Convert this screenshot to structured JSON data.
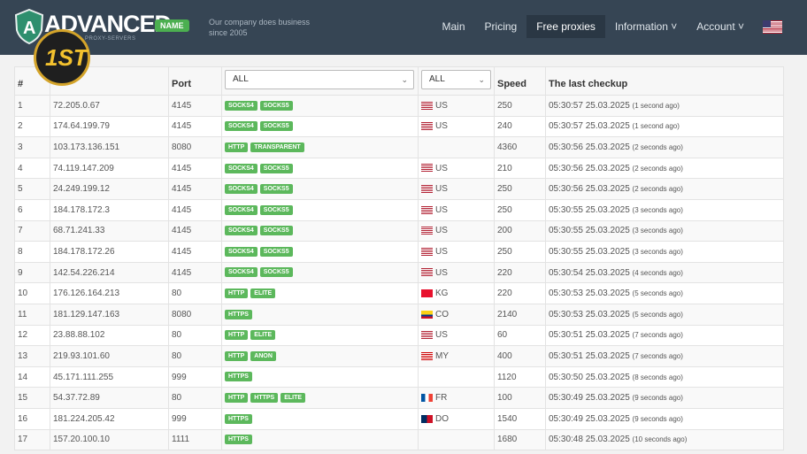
{
  "header": {
    "logo_text": "ADVANCED",
    "logo_badge": "NAME",
    "logo_sub": "PROXY-SERVERS",
    "badge_text": "1ST",
    "tagline": "Our company does business since 2005",
    "nav": [
      "Main",
      "Pricing",
      "Free proxies",
      "Information ˅",
      "Account ˅"
    ],
    "active_nav": "Free proxies",
    "lang_flag": "us-flag-icon"
  },
  "table": {
    "columns": [
      "#",
      "",
      "Port",
      "",
      "",
      "Speed",
      "The last checkup"
    ],
    "type_filter": "ALL",
    "country_filter": "ALL",
    "rows": [
      {
        "n": "1",
        "ip": "72.205.0.67",
        "port": "4145",
        "tags": [
          "SOCKS4",
          "SOCKS5"
        ],
        "cc": "US",
        "speed": "250",
        "time": "05:30:57 25.03.2025",
        "ago": "(1 second ago)"
      },
      {
        "n": "2",
        "ip": "174.64.199.79",
        "port": "4145",
        "tags": [
          "SOCKS4",
          "SOCKS5"
        ],
        "cc": "US",
        "speed": "240",
        "time": "05:30:57 25.03.2025",
        "ago": "(1 second ago)"
      },
      {
        "n": "3",
        "ip": "103.173.136.151",
        "port": "8080",
        "tags": [
          "HTTP",
          "TRANSPARENT"
        ],
        "cc": "",
        "speed": "4360",
        "time": "05:30:56 25.03.2025",
        "ago": "(2 seconds ago)"
      },
      {
        "n": "4",
        "ip": "74.119.147.209",
        "port": "4145",
        "tags": [
          "SOCKS4",
          "SOCKS5"
        ],
        "cc": "US",
        "speed": "210",
        "time": "05:30:56 25.03.2025",
        "ago": "(2 seconds ago)"
      },
      {
        "n": "5",
        "ip": "24.249.199.12",
        "port": "4145",
        "tags": [
          "SOCKS4",
          "SOCKS5"
        ],
        "cc": "US",
        "speed": "250",
        "time": "05:30:56 25.03.2025",
        "ago": "(2 seconds ago)"
      },
      {
        "n": "6",
        "ip": "184.178.172.3",
        "port": "4145",
        "tags": [
          "SOCKS4",
          "SOCKS5"
        ],
        "cc": "US",
        "speed": "250",
        "time": "05:30:55 25.03.2025",
        "ago": "(3 seconds ago)"
      },
      {
        "n": "7",
        "ip": "68.71.241.33",
        "port": "4145",
        "tags": [
          "SOCKS4",
          "SOCKS5"
        ],
        "cc": "US",
        "speed": "200",
        "time": "05:30:55 25.03.2025",
        "ago": "(3 seconds ago)"
      },
      {
        "n": "8",
        "ip": "184.178.172.26",
        "port": "4145",
        "tags": [
          "SOCKS4",
          "SOCKS5"
        ],
        "cc": "US",
        "speed": "250",
        "time": "05:30:55 25.03.2025",
        "ago": "(3 seconds ago)"
      },
      {
        "n": "9",
        "ip": "142.54.226.214",
        "port": "4145",
        "tags": [
          "SOCKS4",
          "SOCKS5"
        ],
        "cc": "US",
        "speed": "220",
        "time": "05:30:54 25.03.2025",
        "ago": "(4 seconds ago)"
      },
      {
        "n": "10",
        "ip": "176.126.164.213",
        "port": "80",
        "tags": [
          "HTTP",
          "ELITE"
        ],
        "cc": "KG",
        "speed": "220",
        "time": "05:30:53 25.03.2025",
        "ago": "(5 seconds ago)"
      },
      {
        "n": "11",
        "ip": "181.129.147.163",
        "port": "8080",
        "tags": [
          "HTTPS"
        ],
        "cc": "CO",
        "speed": "2140",
        "time": "05:30:53 25.03.2025",
        "ago": "(5 seconds ago)"
      },
      {
        "n": "12",
        "ip": "23.88.88.102",
        "port": "80",
        "tags": [
          "HTTP",
          "ELITE"
        ],
        "cc": "US",
        "speed": "60",
        "time": "05:30:51 25.03.2025",
        "ago": "(7 seconds ago)"
      },
      {
        "n": "13",
        "ip": "219.93.101.60",
        "port": "80",
        "tags": [
          "HTTP",
          "ANON"
        ],
        "cc": "MY",
        "speed": "400",
        "time": "05:30:51 25.03.2025",
        "ago": "(7 seconds ago)"
      },
      {
        "n": "14",
        "ip": "45.171.111.255",
        "port": "999",
        "tags": [
          "HTTPS"
        ],
        "cc": "",
        "speed": "1120",
        "time": "05:30:50 25.03.2025",
        "ago": "(8 seconds ago)"
      },
      {
        "n": "15",
        "ip": "54.37.72.89",
        "port": "80",
        "tags": [
          "HTTP",
          "HTTPS",
          "ELITE"
        ],
        "cc": "FR",
        "speed": "100",
        "time": "05:30:49 25.03.2025",
        "ago": "(9 seconds ago)"
      },
      {
        "n": "16",
        "ip": "181.224.205.42",
        "port": "999",
        "tags": [
          "HTTPS"
        ],
        "cc": "DO",
        "speed": "1540",
        "time": "05:30:49 25.03.2025",
        "ago": "(9 seconds ago)"
      },
      {
        "n": "17",
        "ip": "157.20.100.10",
        "port": "1111",
        "tags": [
          "HTTPS"
        ],
        "cc": "",
        "speed": "1680",
        "time": "05:30:48 25.03.2025",
        "ago": "(10 seconds ago)"
      }
    ]
  }
}
